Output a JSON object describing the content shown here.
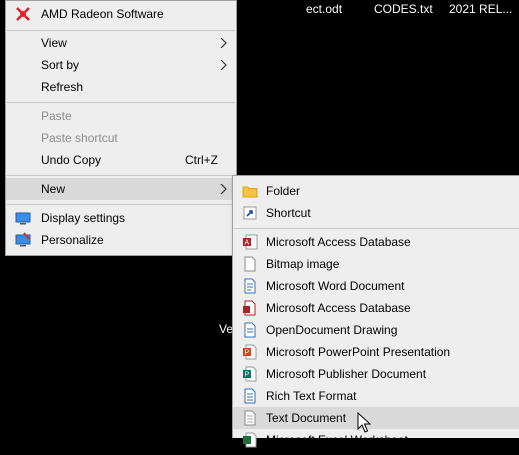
{
  "desktop": {
    "file_1": "ect.odt",
    "file_2": "CODES.txt",
    "file_3": "2021 REL...",
    "fragment": "Ve"
  },
  "context_menu": {
    "amd": "AMD Radeon Software",
    "view": "View",
    "sort_by": "Sort by",
    "refresh": "Refresh",
    "paste": "Paste",
    "paste_shortcut": "Paste shortcut",
    "undo_copy": "Undo Copy",
    "undo_shortcut": "Ctrl+Z",
    "new": "New",
    "display_settings": "Display settings",
    "personalize": "Personalize"
  },
  "new_submenu": {
    "items": [
      "Folder",
      "Shortcut",
      "Microsoft Access Database",
      "Bitmap image",
      "Microsoft Word Document",
      "Microsoft Access Database",
      "OpenDocument Drawing",
      "Microsoft PowerPoint Presentation",
      "Microsoft Publisher Document",
      "Rich Text Format",
      "Text Document",
      "Microsoft Excel Worksheet"
    ]
  },
  "icons": {
    "amd": "amd-radeon-icon",
    "display": "monitor-icon",
    "personalize": "paintbrush-monitor-icon",
    "folder": "folder-icon",
    "shortcut": "shortcut-arrow-icon",
    "access": "access-db-icon",
    "bitmap": "document-icon",
    "word": "document-icon",
    "access2": "access-doc-icon",
    "odg": "document-icon",
    "ppt": "powerpoint-icon",
    "pub": "publisher-icon",
    "rtf": "document-icon",
    "txt": "document-icon"
  },
  "colors": {
    "menu_bg": "#eeeeee",
    "highlight": "#d9d9d9",
    "disabled_text": "#8c8c8c",
    "amd_red": "#e0202a",
    "folder_yellow": "#f5c242"
  }
}
